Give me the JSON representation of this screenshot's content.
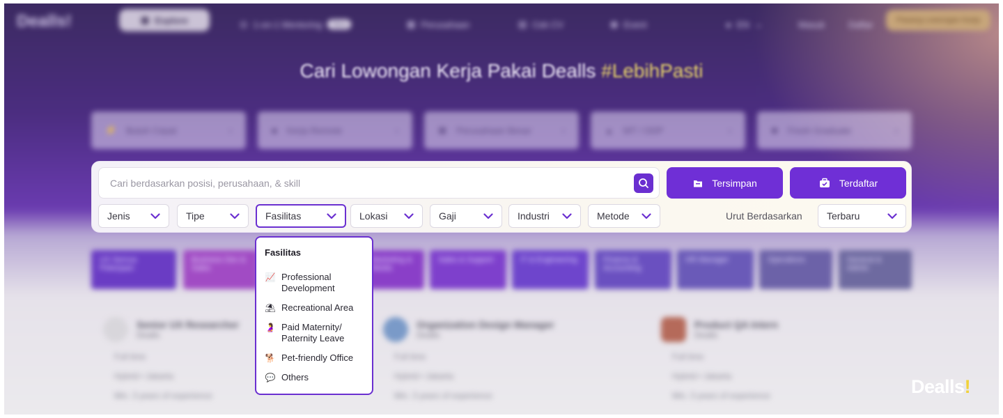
{
  "header": {
    "logo": "Dealls!",
    "nav": [
      {
        "label": "Explore",
        "icon": "compass-icon"
      },
      {
        "label": "1-on-1 Mentoring",
        "badge": "New",
        "icon": "mentor-icon"
      },
      {
        "label": "Perusahaan",
        "icon": "building-icon"
      },
      {
        "label": "Cek CV",
        "icon": "cv-icon"
      },
      {
        "label": "Event",
        "icon": "event-icon"
      }
    ],
    "lang": "EN",
    "masuk": "Masuk",
    "daftar": "Daftar",
    "cta": "Pasang Lowongan Kerja"
  },
  "hero": {
    "title": "Cari Lowongan Kerja Pakai Dealls",
    "highlight": "#LebihPasti"
  },
  "categories": [
    {
      "label": "Butuh Cepat",
      "icon": "lightning-icon"
    },
    {
      "label": "Kerja Remote",
      "icon": "laptop-icon"
    },
    {
      "label": "Perusahaan Besar",
      "icon": "office-icon"
    },
    {
      "label": "MT / ODP",
      "icon": "briefcase-icon"
    },
    {
      "label": "Fresh Graduate",
      "icon": "graduate-icon"
    }
  ],
  "search": {
    "placeholder": "Cari berdasarkan posisi, perusahaan, & skill",
    "value": ""
  },
  "actions": {
    "saved": "Tersimpan",
    "applied": "Terdaftar"
  },
  "filters": [
    {
      "label": "Jenis"
    },
    {
      "label": "Tipe"
    },
    {
      "label": "Fasilitas",
      "active": true
    },
    {
      "label": "Lokasi"
    },
    {
      "label": "Gaji"
    },
    {
      "label": "Industri"
    },
    {
      "label": "Metode"
    }
  ],
  "sort": {
    "label": "Urut Berdasarkan",
    "value": "Terbaru"
  },
  "facility_dropdown": {
    "title": "Fasilitas",
    "items": [
      {
        "label": "Professional Development",
        "icon": "chart-icon"
      },
      {
        "label": "Recreational Area",
        "icon": "beach-icon"
      },
      {
        "label": "Paid Maternity/ Paternity Leave",
        "icon": "pregnant-icon"
      },
      {
        "label": "Pet-friendly Office",
        "icon": "dog-icon"
      },
      {
        "label": "Others",
        "icon": "speech-bubble-icon"
      }
    ]
  },
  "tags": [
    "UX Semua Pekerjaan",
    "Business Dev & Sales",
    "",
    "Marketing & Media",
    "Sales & Support",
    "IT & Engineering",
    "Finance & Accounting",
    "HR Manager",
    "Operations",
    "General & Admin"
  ],
  "jobs": [
    {
      "title": "Senior UX Researcher",
      "company": "Dealls",
      "line1": "Full time",
      "line2": "Hybrid • Jakarta",
      "line3": "Min. 3 years of experience"
    },
    {
      "title": "Organization Design Manager",
      "company": "Dealls",
      "line1": "Full time",
      "line2": "Hybrid • Jakarta",
      "line3": "Min. 3 years of experience"
    },
    {
      "title": "Product QA Intern",
      "company": "Dealls",
      "line1": "Full time",
      "line2": "Hybrid • Jakarta",
      "line3": "Min. 3 years of experience"
    }
  ],
  "watermark": {
    "text": "Dealls",
    "bang": "!"
  },
  "colors": {
    "accent": "#6a2fd0",
    "highlight": "#e9d46a",
    "bang": "#f1d23a"
  }
}
